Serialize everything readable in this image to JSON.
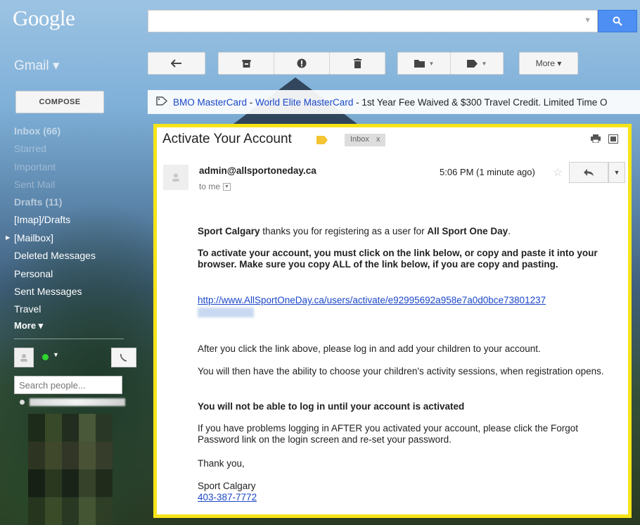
{
  "header": {
    "logo": "Google",
    "search_placeholder": "",
    "app_label": "Gmail ▾"
  },
  "toolbar": {
    "more_label": "More ▾"
  },
  "compose_label": "COMPOSE",
  "ad": {
    "link1": "BMO MasterCard",
    "sep": " - ",
    "link2": "World Elite MasterCard",
    "rest": " - 1st Year Fee Waived & $300 Travel Credit. Limited Time O"
  },
  "sidebar": {
    "items": [
      {
        "label": "Inbox (66)"
      },
      {
        "label": "Starred"
      },
      {
        "label": "Important"
      },
      {
        "label": "Sent Mail"
      },
      {
        "label": "Drafts (11)"
      },
      {
        "label": "[Imap]/Drafts"
      },
      {
        "label": "[Mailbox]"
      },
      {
        "label": "Deleted Messages"
      },
      {
        "label": "Personal"
      },
      {
        "label": "Sent Messages"
      },
      {
        "label": "Travel"
      },
      {
        "label": "More ▾"
      }
    ],
    "search_people_placeholder": "Search people..."
  },
  "email": {
    "subject": "Activate Your Account",
    "inbox_chip": "Inbox",
    "inbox_chip_close": "x",
    "sender": "admin@allsportoneday.ca",
    "to": "to me",
    "time": "5:06 PM (1 minute ago)",
    "p1_org": "Sport Calgary",
    "p1_mid": " thanks you for registering as a user for ",
    "p1_product": "All Sport One Day",
    "p1_end": ".",
    "p2": "To activate your account, you must click on the link below, or copy and paste it into your browser. Make sure you copy ALL of the link below, if you are copy and pasting.",
    "activation_link": "http://www.AllSportOneDay.ca/users/activate/e92995692a958e7a0d0bce73801237",
    "p3": "After you click the link above, please log in and add your children to your account.",
    "p4": "You will then have the ability to choose your children's activity sessions, when registration opens.",
    "p5": "You will not be able to log in until your account is activated",
    "p6": "If you have problems logging in AFTER you activated your account, please click the Forgot Password link on the login screen and re-set your password.",
    "thanks": "Thank you,",
    "signature_name": "Sport Calgary",
    "signature_phone": "403-387-7772"
  },
  "colors": {
    "highlight_border": "#f6e418",
    "link": "#1a47c8",
    "search_button": "#4d8ff3",
    "label_tag": "#f4c431"
  }
}
